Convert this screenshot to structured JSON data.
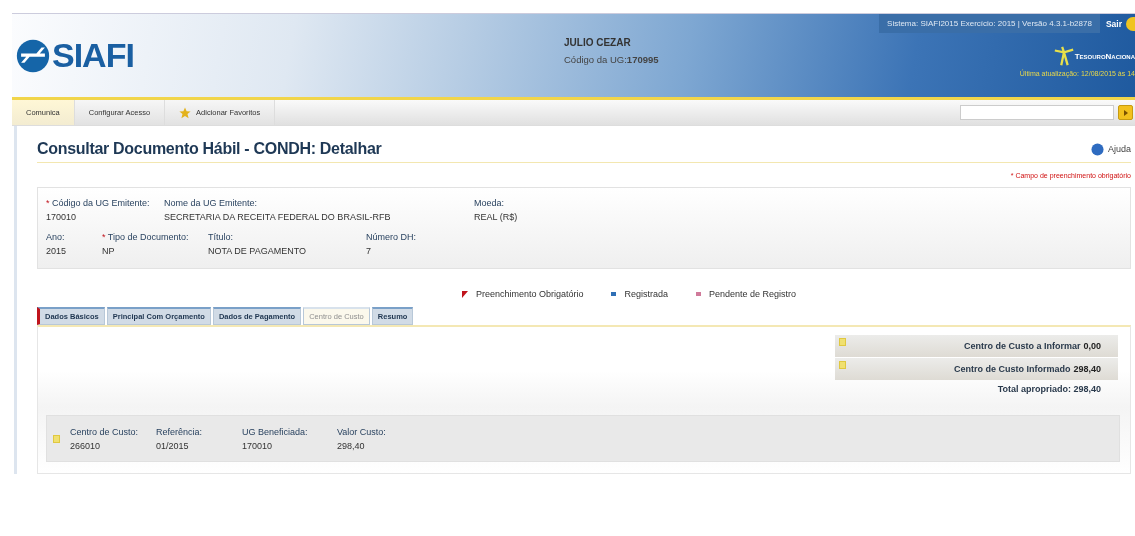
{
  "header": {
    "logo": "SIAFI",
    "user_name": "JULIO CEZAR",
    "ug_label": "Código da UG:",
    "ug_value": "170995",
    "system_info": "Sistema: SIAFI2015 Exercício: 2015 | Versão 4.3.1-b2878",
    "logout": "Sair",
    "brand": "TesouroNaciona",
    "last_update": "Última atualização: 12/08/2015 às 14"
  },
  "nav": {
    "items": [
      {
        "label": "Comunica",
        "selected": true,
        "kind": "plain"
      },
      {
        "label": "Configurar Acesso",
        "selected": false,
        "kind": "plain"
      },
      {
        "label": "Adicionar Favoritos",
        "selected": false,
        "kind": "star"
      }
    ]
  },
  "page": {
    "required_marker": "*",
    "title": "Consultar Documento Hábil - CONDH: Detalhar",
    "help": "Ajuda",
    "required_note": "* Campo de preenchimento obrigatório"
  },
  "fields": [
    [
      {
        "label": "Código da UG Emitente:",
        "value": "170010",
        "required": true
      },
      {
        "label": "Nome da UG Emitente:",
        "value": "SECRETARIA DA RECEITA FEDERAL DO BRASIL-RFB",
        "required": false
      },
      {
        "label": "Moeda:",
        "value": "REAL (R$)",
        "required": false
      }
    ],
    [
      {
        "label": "Ano:",
        "value": "2015",
        "required": false
      },
      {
        "label": "Tipo de Documento:",
        "value": "NP",
        "required": true
      },
      {
        "label": "Título:",
        "value": "NOTA DE PAGAMENTO",
        "required": false
      },
      {
        "label": "Número DH:",
        "value": "7",
        "required": false
      }
    ]
  ],
  "legend": [
    {
      "label": "Preenchimento Obrigatório",
      "kind": "corner",
      "color": "#c0141c"
    },
    {
      "label": "Registrada",
      "kind": "bar",
      "color": "#2f6fb5"
    },
    {
      "label": "Pendente de Registro",
      "kind": "bar",
      "color": "#d07a9a"
    }
  ],
  "tabs": [
    {
      "label": "Dados Básicos",
      "selected": false,
      "required": true
    },
    {
      "label": "Principal Com Orçamento",
      "selected": false,
      "required": false
    },
    {
      "label": "Dados de Pagamento",
      "selected": false,
      "required": false
    },
    {
      "label": "Centro de Custo",
      "selected": true,
      "required": false
    },
    {
      "label": "Resumo",
      "selected": false,
      "required": false
    }
  ],
  "summary": {
    "rows": [
      {
        "label": "Centro de Custo a Informar",
        "value": "0,00"
      },
      {
        "label": "Centro de Custo Informado",
        "value": "298,40"
      }
    ],
    "total": "Total apropriado: 298,40"
  },
  "cost_center": [
    {
      "label": "Centro de Custo:",
      "value": "266010"
    },
    {
      "label": "Referência:",
      "value": "01/2015"
    },
    {
      "label": "UG Beneficiada:",
      "value": "170010"
    },
    {
      "label": "Valor Custo:",
      "value": "298,40"
    }
  ]
}
